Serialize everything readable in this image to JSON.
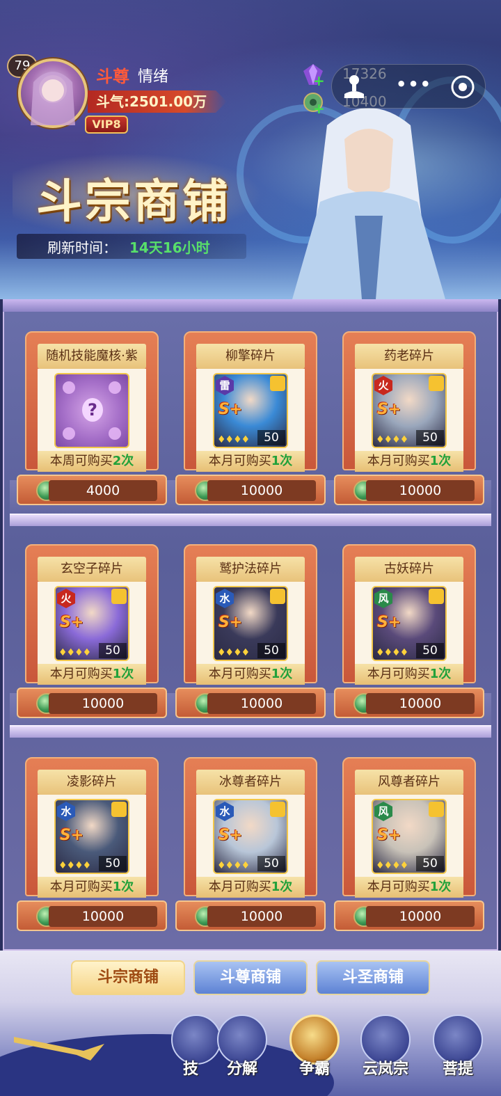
{
  "player": {
    "level": "79",
    "title": "斗尊",
    "name": "情绪",
    "power": "斗气:2501.00万",
    "vip": "VIP8"
  },
  "currencies": [
    {
      "amount": "17326",
      "icon": "purple-crystal-icon"
    },
    {
      "amount": "10400",
      "icon": "jade-coin-icon"
    }
  ],
  "capsule": {
    "more": "•••"
  },
  "shop": {
    "title": "斗宗商铺",
    "refresh_label": "刷新时间：",
    "refresh_value": "14天16小时"
  },
  "items": [
    {
      "name": "随机技能魔核·紫",
      "limit_prefix": "本周可购买",
      "limit_count": "2次",
      "price": "4000",
      "type": "core"
    },
    {
      "name": "柳擎碎片",
      "element": "雷",
      "element_color": "#5a3aa8",
      "limit_prefix": "本月可购买",
      "limit_count": "1次",
      "price": "10000",
      "level": "50",
      "portrait_color": "#3a8ad6"
    },
    {
      "name": "药老碎片",
      "element": "火",
      "element_color": "#c8281e",
      "limit_prefix": "本月可购买",
      "limit_count": "1次",
      "price": "10000",
      "level": "50",
      "portrait_color": "#9aa7bc"
    },
    {
      "name": "玄空子碎片",
      "element": "火",
      "element_color": "#c8281e",
      "limit_prefix": "本月可购买",
      "limit_count": "1次",
      "price": "10000",
      "level": "50",
      "portrait_color": "#8a6ad8"
    },
    {
      "name": "鹫护法碎片",
      "element": "水",
      "element_color": "#2a5ab8",
      "limit_prefix": "本月可购买",
      "limit_count": "1次",
      "price": "10000",
      "level": "50",
      "portrait_color": "#3a3a5a"
    },
    {
      "name": "古妖碎片",
      "element": "风",
      "element_color": "#2a8a4a",
      "limit_prefix": "本月可购买",
      "limit_count": "1次",
      "price": "10000",
      "level": "50",
      "portrait_color": "#5a4a7a"
    },
    {
      "name": "凌影碎片",
      "element": "水",
      "element_color": "#2a5ab8",
      "limit_prefix": "本月可购买",
      "limit_count": "1次",
      "price": "10000",
      "level": "50",
      "portrait_color": "#4a5a7a"
    },
    {
      "name": "冰尊者碎片",
      "element": "水",
      "element_color": "#2a5ab8",
      "limit_prefix": "本月可购买",
      "limit_count": "1次",
      "price": "10000",
      "level": "50",
      "portrait_color": "#b8c6d8"
    },
    {
      "name": "风尊者碎片",
      "element": "风",
      "element_color": "#2a8a4a",
      "limit_prefix": "本月可购买",
      "limit_count": "1次",
      "price": "10000",
      "level": "50",
      "portrait_color": "#c8c2b8"
    }
  ],
  "tabs": [
    {
      "label": "斗宗商铺",
      "active": true
    },
    {
      "label": "斗尊商铺",
      "active": false
    },
    {
      "label": "斗圣商铺",
      "active": false
    }
  ],
  "nav": [
    {
      "label": "技",
      "icon": "skill-icon"
    },
    {
      "label": "分解",
      "icon": "decompose-icon"
    },
    {
      "label": "争霸",
      "icon": "trophy-icon"
    },
    {
      "label": "云岚宗",
      "icon": "sect-icon"
    },
    {
      "label": "菩提",
      "icon": "tree-icon"
    }
  ]
}
